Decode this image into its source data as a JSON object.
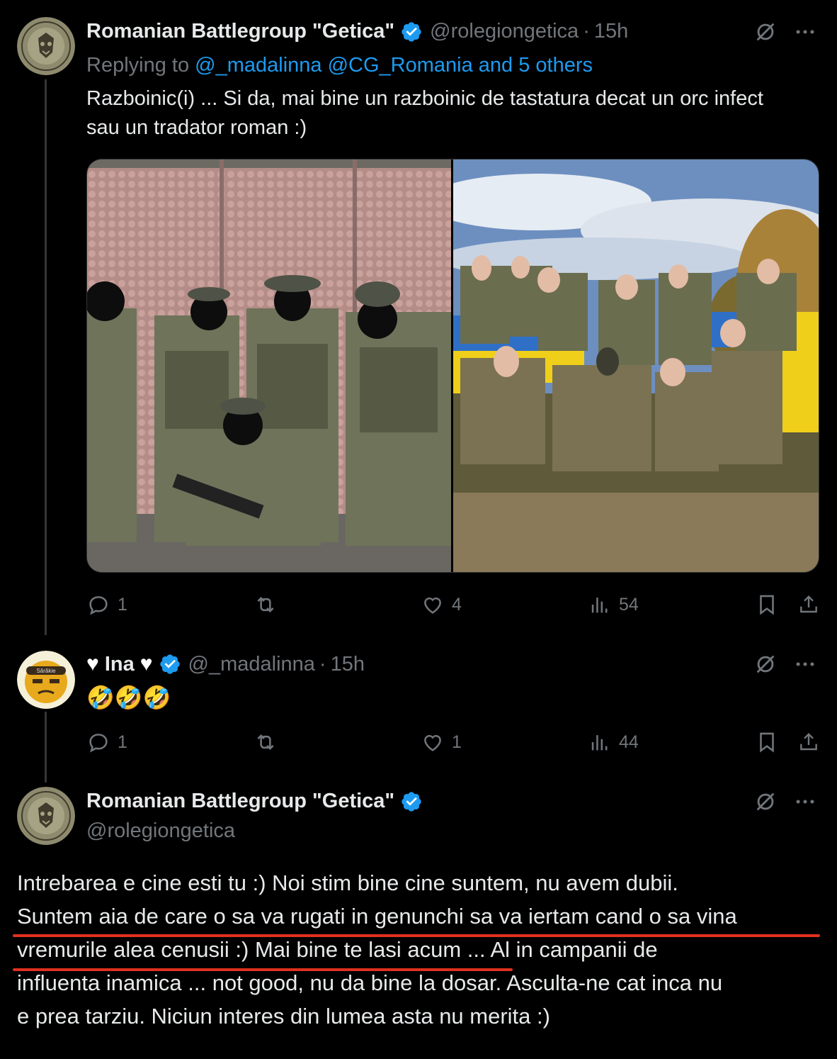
{
  "tweet1": {
    "name": "Romanian Battlegroup \"Getica\"",
    "handle": "@rolegiongetica",
    "time": "15h",
    "reply_prefix": "Replying to ",
    "reply_mentions": "@_madalinna @CG_Romania and 5 others",
    "text_line1": "Razboinic(i) ... Si da, mai bine un razboinic de tastatura decat un orc infect",
    "text_line2": "sau un tradator roman :)",
    "stats": {
      "replies": "1",
      "reposts": "",
      "likes": "4",
      "views": "54"
    }
  },
  "tweet2": {
    "name": "Ina",
    "handle": "@_madalinna",
    "time": "15h",
    "avatar_label": "Sărăkie",
    "text": "🤣🤣🤣",
    "stats": {
      "replies": "1",
      "reposts": "",
      "likes": "1",
      "views": "44"
    }
  },
  "tweet3": {
    "name": "Romanian Battlegroup \"Getica\"",
    "handle": "@rolegiongetica",
    "text_line1": "Intrebarea e cine esti tu :) Noi stim bine cine suntem, nu avem dubii.",
    "text_line2": "Suntem aia de care o sa va rugati in genunchi sa va iertam cand o sa vina",
    "text_line3": "vremurile alea cenusii :) Mai bine te lasi acum ... Al in campanii de",
    "text_line4": "influenta inamica ... not good, nu da bine la dosar. Asculta-ne cat inca nu",
    "text_line5": "e prea tarziu. Niciun interes din lumea asta nu merita :)"
  },
  "colors": {
    "background": "#000000",
    "text": "#e7e9ea",
    "muted": "#71767b",
    "link": "#1d9bf0",
    "verified": "#1d9bf0",
    "annotation": "#e0301e"
  },
  "icons": [
    "verified-badge-icon",
    "grok-icon",
    "more-icon",
    "reply-icon",
    "repost-icon",
    "like-icon",
    "views-icon",
    "bookmark-icon",
    "share-icon"
  ]
}
